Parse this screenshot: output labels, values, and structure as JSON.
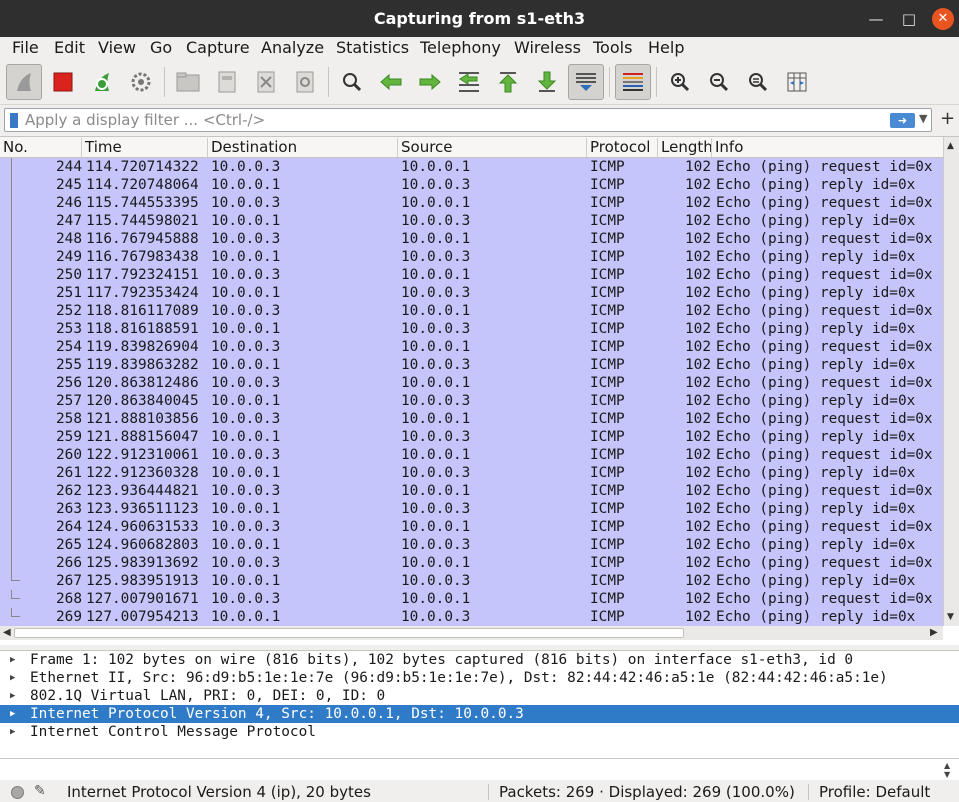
{
  "window": {
    "title": "Capturing from s1-eth3"
  },
  "menu": [
    "File",
    "Edit",
    "View",
    "Go",
    "Capture",
    "Analyze",
    "Statistics",
    "Telephony",
    "Wireless",
    "Tools",
    "Help"
  ],
  "filter": {
    "placeholder": "Apply a display filter ... <Ctrl-/>"
  },
  "columns": [
    "No.",
    "Time",
    "Destination",
    "Source",
    "Protocol",
    "Length",
    "Info"
  ],
  "packets": [
    {
      "no": "244",
      "time": "114.720714322",
      "dst": "10.0.0.3",
      "src": "10.0.0.1",
      "proto": "ICMP",
      "len": "102",
      "info": "Echo (ping) request  id=0x"
    },
    {
      "no": "245",
      "time": "114.720748064",
      "dst": "10.0.0.1",
      "src": "10.0.0.3",
      "proto": "ICMP",
      "len": "102",
      "info": "Echo (ping) reply    id=0x"
    },
    {
      "no": "246",
      "time": "115.744553395",
      "dst": "10.0.0.3",
      "src": "10.0.0.1",
      "proto": "ICMP",
      "len": "102",
      "info": "Echo (ping) request  id=0x"
    },
    {
      "no": "247",
      "time": "115.744598021",
      "dst": "10.0.0.1",
      "src": "10.0.0.3",
      "proto": "ICMP",
      "len": "102",
      "info": "Echo (ping) reply    id=0x"
    },
    {
      "no": "248",
      "time": "116.767945888",
      "dst": "10.0.0.3",
      "src": "10.0.0.1",
      "proto": "ICMP",
      "len": "102",
      "info": "Echo (ping) request  id=0x"
    },
    {
      "no": "249",
      "time": "116.767983438",
      "dst": "10.0.0.1",
      "src": "10.0.0.3",
      "proto": "ICMP",
      "len": "102",
      "info": "Echo (ping) reply    id=0x"
    },
    {
      "no": "250",
      "time": "117.792324151",
      "dst": "10.0.0.3",
      "src": "10.0.0.1",
      "proto": "ICMP",
      "len": "102",
      "info": "Echo (ping) request  id=0x"
    },
    {
      "no": "251",
      "time": "117.792353424",
      "dst": "10.0.0.1",
      "src": "10.0.0.3",
      "proto": "ICMP",
      "len": "102",
      "info": "Echo (ping) reply    id=0x"
    },
    {
      "no": "252",
      "time": "118.816117089",
      "dst": "10.0.0.3",
      "src": "10.0.0.1",
      "proto": "ICMP",
      "len": "102",
      "info": "Echo (ping) request  id=0x"
    },
    {
      "no": "253",
      "time": "118.816188591",
      "dst": "10.0.0.1",
      "src": "10.0.0.3",
      "proto": "ICMP",
      "len": "102",
      "info": "Echo (ping) reply    id=0x"
    },
    {
      "no": "254",
      "time": "119.839826904",
      "dst": "10.0.0.3",
      "src": "10.0.0.1",
      "proto": "ICMP",
      "len": "102",
      "info": "Echo (ping) request  id=0x"
    },
    {
      "no": "255",
      "time": "119.839863282",
      "dst": "10.0.0.1",
      "src": "10.0.0.3",
      "proto": "ICMP",
      "len": "102",
      "info": "Echo (ping) reply    id=0x"
    },
    {
      "no": "256",
      "time": "120.863812486",
      "dst": "10.0.0.3",
      "src": "10.0.0.1",
      "proto": "ICMP",
      "len": "102",
      "info": "Echo (ping) request  id=0x"
    },
    {
      "no": "257",
      "time": "120.863840045",
      "dst": "10.0.0.1",
      "src": "10.0.0.3",
      "proto": "ICMP",
      "len": "102",
      "info": "Echo (ping) reply    id=0x"
    },
    {
      "no": "258",
      "time": "121.888103856",
      "dst": "10.0.0.3",
      "src": "10.0.0.1",
      "proto": "ICMP",
      "len": "102",
      "info": "Echo (ping) request  id=0x"
    },
    {
      "no": "259",
      "time": "121.888156047",
      "dst": "10.0.0.1",
      "src": "10.0.0.3",
      "proto": "ICMP",
      "len": "102",
      "info": "Echo (ping) reply    id=0x"
    },
    {
      "no": "260",
      "time": "122.912310061",
      "dst": "10.0.0.3",
      "src": "10.0.0.1",
      "proto": "ICMP",
      "len": "102",
      "info": "Echo (ping) request  id=0x"
    },
    {
      "no": "261",
      "time": "122.912360328",
      "dst": "10.0.0.1",
      "src": "10.0.0.3",
      "proto": "ICMP",
      "len": "102",
      "info": "Echo (ping) reply    id=0x"
    },
    {
      "no": "262",
      "time": "123.936444821",
      "dst": "10.0.0.3",
      "src": "10.0.0.1",
      "proto": "ICMP",
      "len": "102",
      "info": "Echo (ping) request  id=0x"
    },
    {
      "no": "263",
      "time": "123.936511123",
      "dst": "10.0.0.1",
      "src": "10.0.0.3",
      "proto": "ICMP",
      "len": "102",
      "info": "Echo (ping) reply    id=0x"
    },
    {
      "no": "264",
      "time": "124.960631533",
      "dst": "10.0.0.3",
      "src": "10.0.0.1",
      "proto": "ICMP",
      "len": "102",
      "info": "Echo (ping) request  id=0x"
    },
    {
      "no": "265",
      "time": "124.960682803",
      "dst": "10.0.0.1",
      "src": "10.0.0.3",
      "proto": "ICMP",
      "len": "102",
      "info": "Echo (ping) reply    id=0x"
    },
    {
      "no": "266",
      "time": "125.983913692",
      "dst": "10.0.0.3",
      "src": "10.0.0.1",
      "proto": "ICMP",
      "len": "102",
      "info": "Echo (ping) request  id=0x"
    },
    {
      "no": "267",
      "time": "125.983951913",
      "dst": "10.0.0.1",
      "src": "10.0.0.3",
      "proto": "ICMP",
      "len": "102",
      "info": "Echo (ping) reply    id=0x"
    },
    {
      "no": "268",
      "time": "127.007901671",
      "dst": "10.0.0.3",
      "src": "10.0.0.1",
      "proto": "ICMP",
      "len": "102",
      "info": "Echo (ping) request  id=0x"
    },
    {
      "no": "269",
      "time": "127.007954213",
      "dst": "10.0.0.1",
      "src": "10.0.0.3",
      "proto": "ICMP",
      "len": "102",
      "info": "Echo (ping) reply    id=0x"
    }
  ],
  "details": [
    {
      "text": "Frame 1: 102 bytes on wire (816 bits), 102 bytes captured (816 bits) on interface s1-eth3, id 0",
      "selected": false
    },
    {
      "text": "Ethernet II, Src: 96:d9:b5:1e:1e:7e (96:d9:b5:1e:1e:7e), Dst: 82:44:42:46:a5:1e (82:44:42:46:a5:1e)",
      "selected": false
    },
    {
      "text": "802.1Q Virtual LAN, PRI: 0, DEI: 0, ID: 0",
      "selected": false
    },
    {
      "text": "Internet Protocol Version 4, Src: 10.0.0.1, Dst: 10.0.0.3",
      "selected": true
    },
    {
      "text": "Internet Control Message Protocol",
      "selected": false
    }
  ],
  "status": {
    "field": "Internet Protocol Version 4 (ip), 20 bytes",
    "packets": "Packets: 269 · Displayed: 269 (100.0%)",
    "profile": "Profile: Default"
  },
  "colors": {
    "row_bg": "#c5c5fc",
    "selected_bg": "#2f7bc8",
    "titlebar_bg": "#2f2f2f",
    "close_btn": "#e95420"
  }
}
